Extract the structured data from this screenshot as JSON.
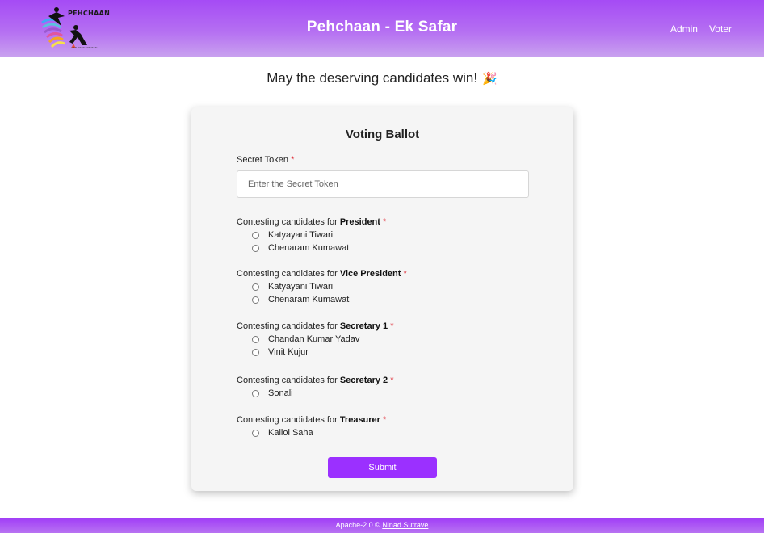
{
  "header": {
    "logo_text": "PEHCHAAN",
    "logo_sub": "A STUDENT INITIATIVE",
    "title": "Pehchaan - Ek Safar",
    "nav": [
      "Admin",
      "Voter"
    ]
  },
  "tagline": "May the deserving candidates win!",
  "ballot": {
    "title": "Voting Ballot",
    "token_label": "Secret Token",
    "required_mark": "*",
    "token_placeholder": "Enter the Secret Token",
    "token_value": "",
    "contest_prefix": "Contesting candidates for",
    "positions": [
      {
        "name": "President",
        "candidates": [
          "Katyayani Tiwari",
          "Chenaram Kumawat"
        ]
      },
      {
        "name": "Vice President",
        "candidates": [
          "Katyayani Tiwari",
          "Chenaram Kumawat"
        ]
      },
      {
        "name": "Secretary 1",
        "candidates": [
          "Chandan Kumar Yadav",
          "Vinit Kujur"
        ]
      },
      {
        "name": "Secretary 2",
        "candidates": [
          "Sonali"
        ]
      },
      {
        "name": "Treasurer",
        "candidates": [
          "Kallol Saha"
        ]
      }
    ],
    "submit_label": "Submit"
  },
  "footer": {
    "license_text": "Apache-2.0 ©",
    "author": "Ninad Sutrave"
  },
  "colors": {
    "accent": "#9b30ff",
    "header_top": "#a54bf5",
    "required": "#e0303a"
  }
}
